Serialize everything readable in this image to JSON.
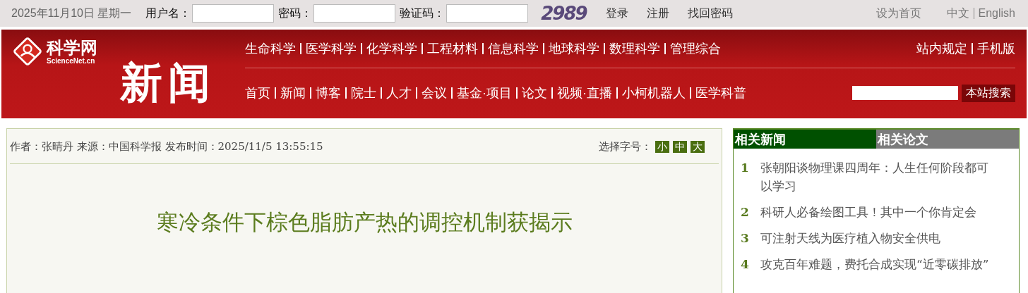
{
  "top_bar": {
    "date": "2025年11月10日 星期一",
    "fields": [
      "用户名：",
      "密码：",
      "验证码："
    ],
    "captcha": "2989",
    "links": [
      "登录",
      "注册",
      "找回密码"
    ],
    "home_link": "设为首页",
    "languages": [
      "中文",
      "English"
    ]
  },
  "header": {
    "logo": {
      "name": "科学网",
      "domain": "ScienceNet.cn"
    },
    "section_title": "新闻",
    "nav_primary": [
      "生命科学",
      "医学科学",
      "化学科学",
      "工程材料",
      "信息科学",
      "地球科学",
      "数理科学",
      "管理综合"
    ],
    "nav_secondary": [
      "首页",
      "新闻",
      "博客",
      "院士",
      "人才",
      "会议",
      "基金·项目",
      "论文",
      "视频·直播",
      "小柯机器人",
      "医学科普"
    ],
    "utility_links": [
      "站内规定",
      "手机版"
    ],
    "search_button": "本站搜索"
  },
  "article": {
    "meta": "作者：张晴丹 来源：中国科学报 发布时间：2025/11/5 13:55:15",
    "font_size_label": "选择字号：",
    "font_sizes": [
      "小",
      "中",
      "大"
    ],
    "title": "寒冷条件下棕色脂肪产热的调控机制获揭示"
  },
  "sidebar": {
    "tabs": [
      {
        "label": "相关新闻",
        "selected": true
      },
      {
        "label": "相关论文",
        "selected": false
      }
    ],
    "items": [
      {
        "number": "1",
        "text": "张朝阳谈物理课四周年：人生任何阶段都可以学习"
      },
      {
        "number": "2",
        "text": "科研人必备绘图工具！其中一个你肯定会"
      },
      {
        "number": "3",
        "text": "可注射天线为医疗植入物安全供电"
      },
      {
        "number": "4",
        "text": "攻克百年难题，费托合成实现“近零碳排放”"
      }
    ]
  }
}
